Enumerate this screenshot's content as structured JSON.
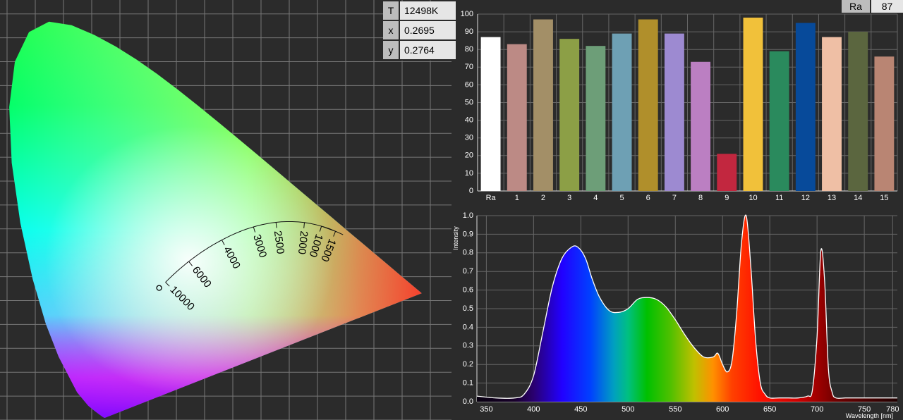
{
  "readout": {
    "rows": [
      {
        "key": "T",
        "value": "12498K"
      },
      {
        "key": "x",
        "value": "0.2695"
      },
      {
        "key": "y",
        "value": "0.2764"
      }
    ]
  },
  "ra_box": {
    "label": "Ra",
    "value": "87"
  },
  "chart_data": [
    {
      "type": "scatter",
      "chart": "cie-1931-chromaticity",
      "point": {
        "x": 0.2695,
        "y": 0.2764
      },
      "locus_labels": [
        "10000",
        "6000",
        "4000",
        "3000",
        "2500",
        "2000",
        "1500",
        "1000"
      ],
      "grid": true
    },
    {
      "type": "bar",
      "chart": "color-rendering-index",
      "categories": [
        "Ra",
        "1",
        "2",
        "3",
        "4",
        "5",
        "6",
        "7",
        "8",
        "9",
        "10",
        "11",
        "12",
        "13",
        "14",
        "15"
      ],
      "values": [
        87,
        83,
        97,
        86,
        82,
        89,
        97,
        89,
        73,
        21,
        98,
        79,
        95,
        87,
        90,
        76
      ],
      "colors": [
        "#ffffff",
        "#bc8a85",
        "#a38f67",
        "#8c9f46",
        "#6d9e78",
        "#6ea0b4",
        "#b08f2b",
        "#9d8ad1",
        "#bb7fc2",
        "#c2273f",
        "#f1c13a",
        "#2a8a5d",
        "#074a9a",
        "#efbfa5",
        "#5b663f",
        "#b98573"
      ],
      "ylim": [
        0,
        100
      ],
      "yticks": [
        "0",
        "10",
        "20",
        "30",
        "40",
        "50",
        "60",
        "70",
        "80",
        "90",
        "100"
      ],
      "grid": true
    },
    {
      "type": "area",
      "chart": "spectrum",
      "xlabel": "Wavelength [nm]",
      "ylabel": "Intensity",
      "xlim": [
        340,
        785
      ],
      "ylim": [
        0,
        1.0
      ],
      "xticks": [
        "350",
        "400",
        "450",
        "500",
        "550",
        "600",
        "650",
        "700",
        "750",
        "780"
      ],
      "yticks": [
        "0.0",
        "0.1",
        "0.2",
        "0.3",
        "0.4",
        "0.5",
        "0.6",
        "0.7",
        "0.8",
        "0.9",
        "1.0"
      ],
      "x": [
        340,
        360,
        380,
        390,
        400,
        410,
        420,
        430,
        440,
        447,
        455,
        462,
        470,
        480,
        490,
        500,
        510,
        520,
        530,
        540,
        550,
        560,
        570,
        580,
        590,
        595,
        600,
        605,
        610,
        615,
        620,
        625,
        630,
        635,
        640,
        645,
        650,
        660,
        670,
        680,
        690,
        695,
        700,
        704,
        708,
        712,
        716,
        720,
        730,
        740,
        760,
        785
      ],
      "y": [
        0.03,
        0.02,
        0.02,
        0.04,
        0.14,
        0.38,
        0.62,
        0.77,
        0.83,
        0.83,
        0.77,
        0.66,
        0.56,
        0.49,
        0.48,
        0.5,
        0.55,
        0.56,
        0.55,
        0.51,
        0.44,
        0.36,
        0.29,
        0.24,
        0.24,
        0.26,
        0.2,
        0.16,
        0.22,
        0.48,
        0.85,
        1.0,
        0.72,
        0.33,
        0.1,
        0.04,
        0.02,
        0.02,
        0.02,
        0.02,
        0.03,
        0.06,
        0.35,
        0.81,
        0.65,
        0.18,
        0.05,
        0.02,
        0.02,
        0.02,
        0.02,
        0.02
      ]
    }
  ]
}
